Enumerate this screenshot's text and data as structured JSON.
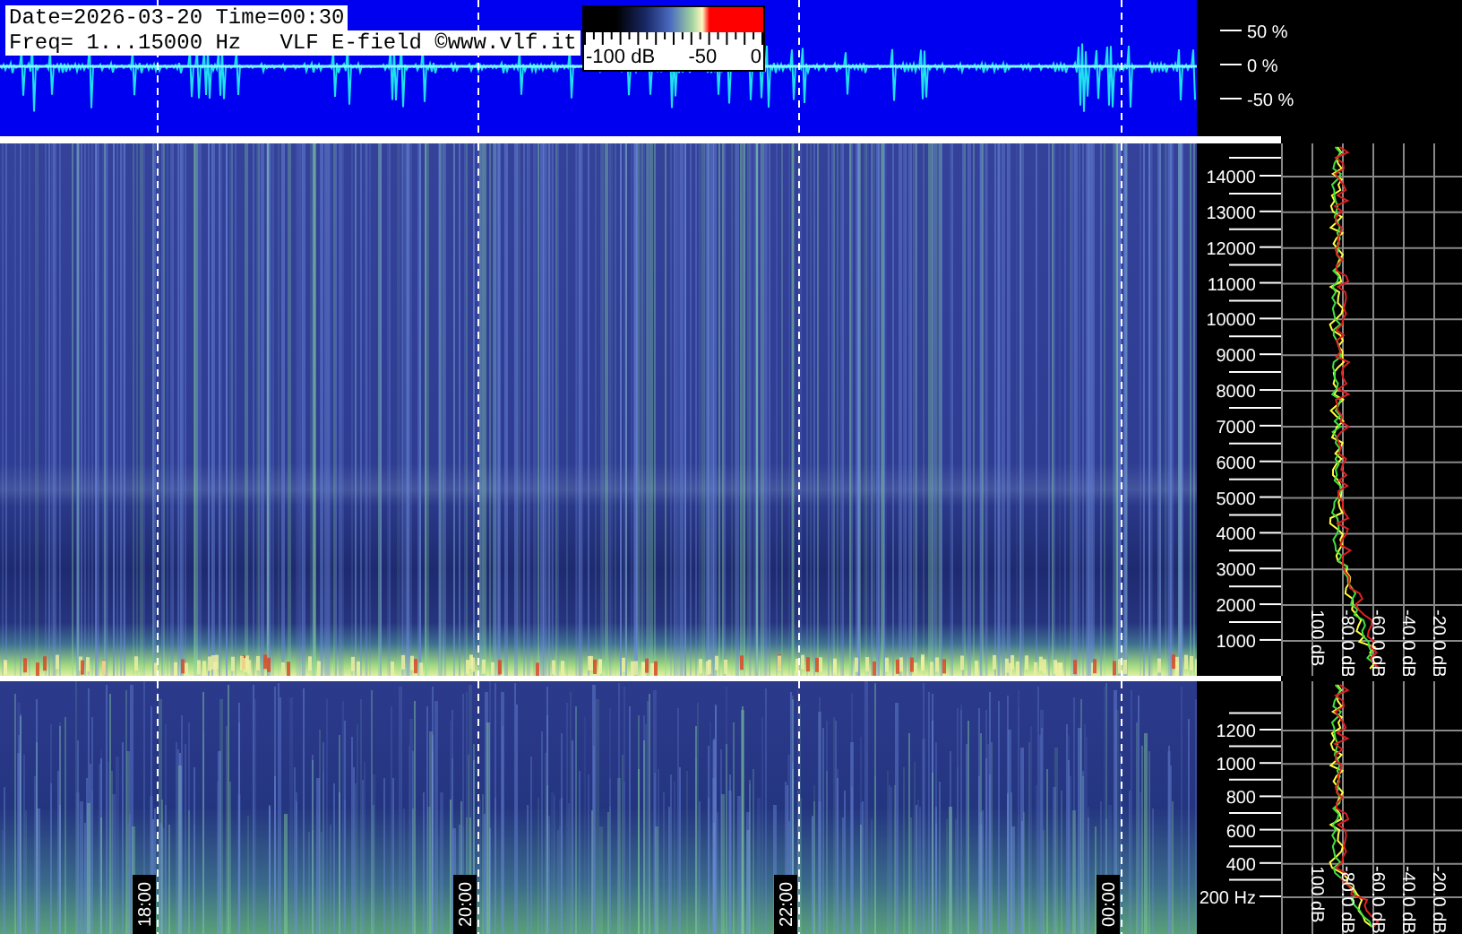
{
  "header": {
    "date_time": "Date=2026-03-20 Time=00:30",
    "info": "Freq= 1...15000 Hz   VLF E-field ©www.vlf.it"
  },
  "colorbar": {
    "labels": [
      "-100 dB",
      "-50",
      "0"
    ]
  },
  "waveform_axis": {
    "labels": [
      "50 %",
      "0 %",
      "-50 %"
    ]
  },
  "upper_panel": {
    "freq_labels": [
      "14000",
      "13000",
      "12000",
      "11000",
      "10000",
      "9000",
      "8000",
      "7000",
      "6000",
      "5000",
      "4000",
      "3000",
      "2000",
      "1000"
    ],
    "db_labels": [
      "100 dB",
      "-80.0 dB",
      "-60.0 dB",
      "-40.0 dB",
      "-20.0 dB"
    ]
  },
  "lower_panel": {
    "freq_labels": [
      "1200",
      "1000",
      "800",
      "600",
      "400",
      "200 Hz"
    ],
    "db_labels": [
      "100 dB",
      "-80.0 dB",
      "-60.0 dB",
      "-40.0 dB",
      "-20.0 dB"
    ]
  },
  "time_labels": [
    "18:00",
    "20:00",
    "22:00",
    "00:00"
  ]
}
